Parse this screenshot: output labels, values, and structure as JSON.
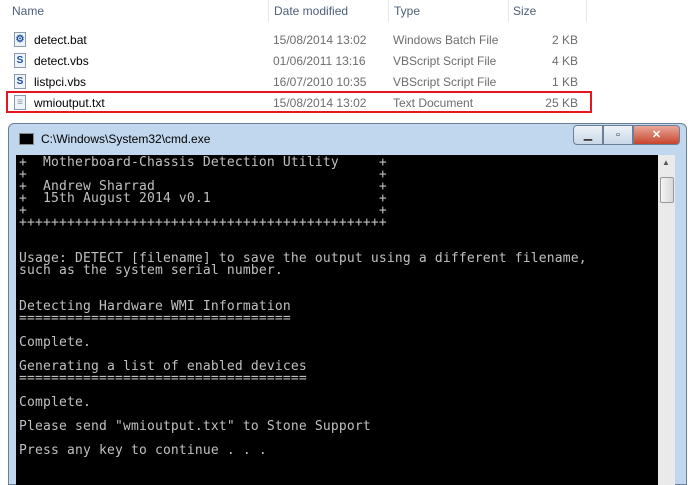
{
  "explorer": {
    "columns": {
      "name": "Name",
      "date": "Date modified",
      "type": "Type",
      "size": "Size"
    },
    "files": [
      {
        "name": "detect.bat",
        "date": "15/08/2014 13:02",
        "type": "Windows Batch File",
        "size": "2 KB",
        "icon": "batch-file-icon"
      },
      {
        "name": "detect.vbs",
        "date": "01/06/2011 13:16",
        "type": "VBScript Script File",
        "size": "4 KB",
        "icon": "vbscript-file-icon"
      },
      {
        "name": "listpci.vbs",
        "date": "16/07/2010 10:35",
        "type": "VBScript Script File",
        "size": "1 KB",
        "icon": "vbscript-file-icon"
      },
      {
        "name": "wmioutput.txt",
        "date": "15/08/2014 13:02",
        "type": "Text Document",
        "size": "25 KB",
        "icon": "text-file-icon"
      }
    ]
  },
  "cmd": {
    "title": "C:\\Windows\\System32\\cmd.exe",
    "output": "+  Motherboard-Chassis Detection Utility     +\n+                                            +\n+  Andrew Sharrad                            +\n+  15th August 2014 v0.1                     +\n+                                            +\n++++++++++++++++++++++++++++++++++++++++++++++\n\n\nUsage: DETECT [filename] to save the output using a different filename,\nsuch as the system serial number.\n\n\nDetecting Hardware WMI Information\n==================================\n\nComplete.\n\nGenerating a list of enabled devices\n====================================\n\nComplete.\n\nPlease send \"wmioutput.txt\" to Stone Support\n\nPress any key to continue . . ."
  },
  "colors": {
    "highlight": "#e8141e"
  }
}
